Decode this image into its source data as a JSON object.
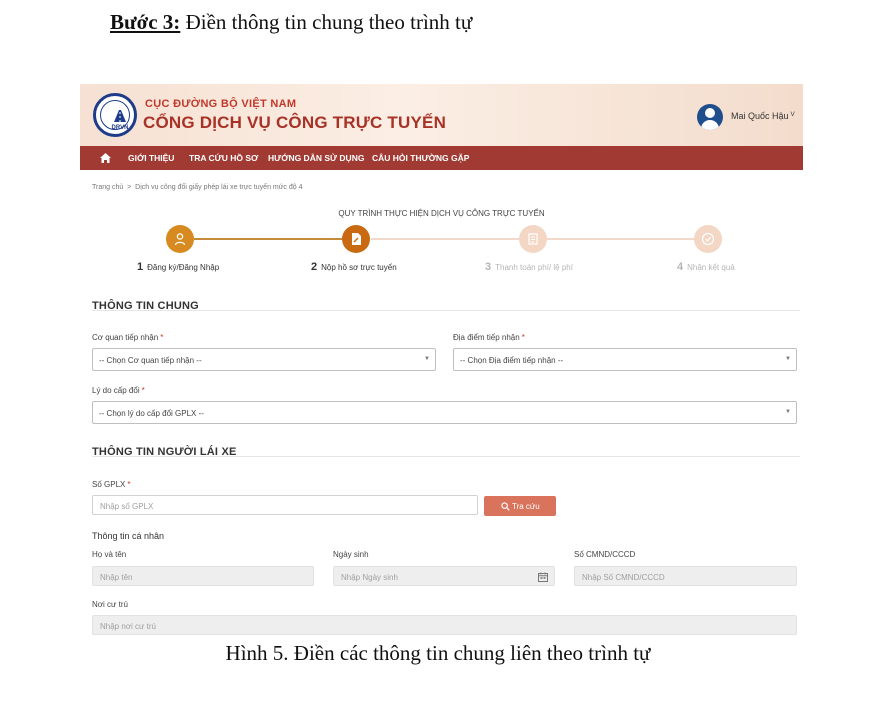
{
  "doc": {
    "step_label": "Bước 3:",
    "step_text": " Điền thông tin chung theo trình tự",
    "caption": "Hình 5. Điền các thông tin chung liên theo trình tự"
  },
  "header": {
    "org_name": "CỤC ĐƯỜNG BỘ VIỆT NAM",
    "portal_name": "CỔNG DỊCH VỤ CÔNG TRỰC TUYẾN",
    "logo_text": "DRVN",
    "user_name": "Mai Quốc Hậu",
    "user_caret": "˅"
  },
  "nav": {
    "items": [
      {
        "label": "GIỚI THIỆU"
      },
      {
        "label": "TRA CỨU HỒ SƠ"
      },
      {
        "label": "HƯỚNG DẪN SỬ DỤNG"
      },
      {
        "label": "CÂU HỎI THƯỜNG GẶP"
      }
    ]
  },
  "breadcrumb": {
    "home": "Trang chủ",
    "separator": ">",
    "current": "Dịch vụ công đổi giấy phép lái xe trực tuyến mức độ 4"
  },
  "process": {
    "title": "QUY TRÌNH THỰC HIỆN DỊCH VỤ CÔNG TRỰC TUYẾN",
    "steps": [
      {
        "num": "1",
        "label": "Đăng ký/Đăng Nhập",
        "status": "done"
      },
      {
        "num": "2",
        "label": "Nộp hồ sơ trực tuyến",
        "status": "active"
      },
      {
        "num": "3",
        "label": "Thanh toán phí/ lệ phí",
        "status": "pending"
      },
      {
        "num": "4",
        "label": "Nhận kết quả",
        "status": "pending"
      }
    ]
  },
  "general": {
    "title": "THÔNG TIN CHUNG",
    "agency_label": "Cơ quan tiếp nhận",
    "agency_value": "-- Chọn Cơ quan tiếp nhận --",
    "location_label": "Địa điểm tiếp nhận",
    "location_value": "-- Chọn Địa điểm tiếp nhận --",
    "reason_label": "Lý do cấp đổi",
    "reason_value": "-- Chọn lý do cấp đổi GPLX --",
    "required_mark": "*",
    "select_arrow": "▼"
  },
  "driver": {
    "title": "THÔNG TIN NGƯỜI LÁI XE",
    "license_label": "Số GPLX",
    "license_placeholder": "Nhập số GPLX",
    "search_button": "Tra cứu",
    "personal_title": "Thông tin cá nhân",
    "name_label": "Họ và tên",
    "name_placeholder": "Nhập tên",
    "dob_label": "Ngày sinh",
    "dob_placeholder": "Nhập Ngày sinh",
    "id_label": "Số CMND/CCCD",
    "id_placeholder": "Nhập Số CMND/CCCD",
    "address_label": "Nơi cư trú",
    "address_placeholder": "Nhập nơi cư trú"
  },
  "colors": {
    "nav_bg": "#a03a33",
    "brand_red": "#a93226",
    "step_done": "#d68a1f",
    "step_active": "#c96a12",
    "step_pending": "#f3d6c4",
    "button": "#d9735b"
  }
}
